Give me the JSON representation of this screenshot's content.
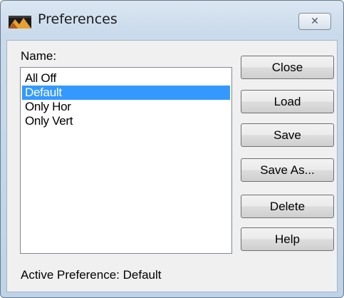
{
  "window": {
    "title": "Preferences",
    "close_glyph": "✕",
    "icon": "preferences-app-icon"
  },
  "list": {
    "label": "Name:",
    "items": [
      "All Off",
      "Default",
      "Only Hor",
      "Only Vert"
    ],
    "selected_index": 1
  },
  "buttons": {
    "close": "Close",
    "load": "Load",
    "save": "Save",
    "save_as": "Save As...",
    "delete": "Delete",
    "help": "Help"
  },
  "status": {
    "active_preference": "Active Preference: Default"
  },
  "colors": {
    "selection": "#3399ff",
    "selection_text": "#ffffff",
    "title_bar": "#c9daeb"
  }
}
